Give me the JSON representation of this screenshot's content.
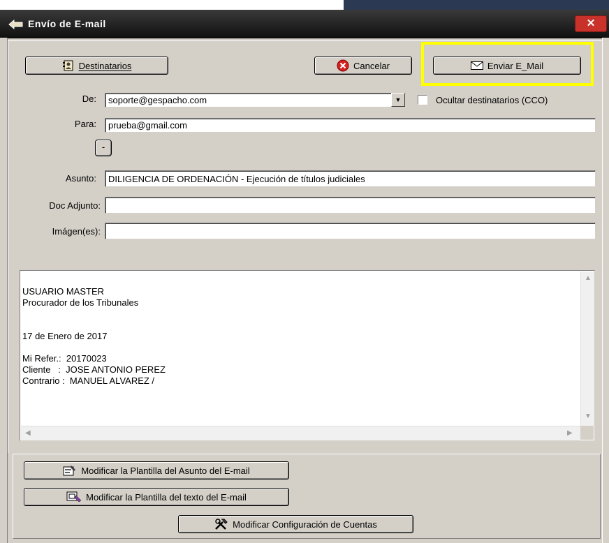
{
  "window": {
    "title": "Envío de E-mail",
    "close_label": "✕"
  },
  "toolbar": {
    "recipients_label": "Destinatarios",
    "cancel_label": "Cancelar",
    "send_label": "Enviar E_Mail"
  },
  "form": {
    "from_label": "De:",
    "from_value": "soporte@gespacho.com",
    "hide_recipients_label": "Ocultar destinatarios (CCO)",
    "hide_recipients_checked": false,
    "to_label": "Para:",
    "to_value": "prueba@gmail.com",
    "minus_label": "-",
    "subject_label": "Asunto:",
    "subject_value": "DILIGENCIA DE ORDENACIÓN - Ejecución de títulos judiciales",
    "attachment_label": "Doc Adjunto:",
    "attachment_value": "",
    "images_label": "Imágen(es):",
    "images_value": ""
  },
  "message": {
    "body": "USUARIO MASTER\nProcurador de los Tribunales\n\n\n17 de Enero de 2017\n\nMi Refer.:  20170023\nCliente   :  JOSE ANTONIO PEREZ\nContrario :  MANUEL ALVAREZ /"
  },
  "footer": {
    "subject_template_label": "Modificar la Plantilla del Asunto del E-mail",
    "text_template_label": "Modificar la Plantilla del texto del E-mail",
    "accounts_config_label": "Modificar Configuración de Cuentas"
  },
  "colors": {
    "highlight": "#ffff00",
    "close_button": "#c8322a",
    "cancel_icon": "#d42020"
  }
}
